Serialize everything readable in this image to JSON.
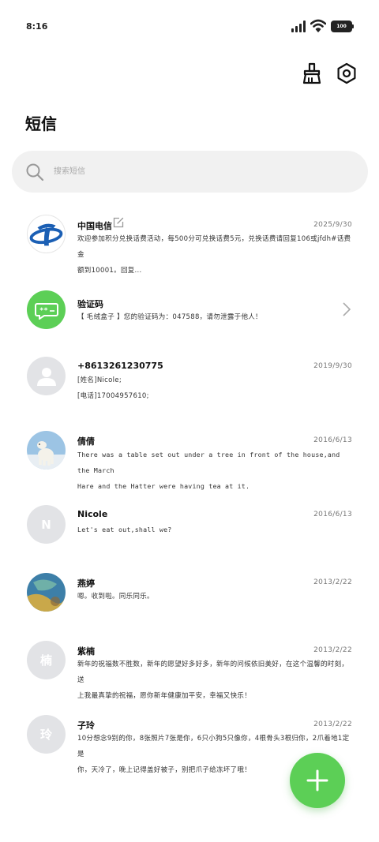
{
  "status_bar": {
    "time": "8:16",
    "battery_level": "100"
  },
  "header": {
    "title": "短信",
    "icons": [
      "brush-icon",
      "settings-icon"
    ]
  },
  "search": {
    "placeholder": "搜索短信",
    "value": ""
  },
  "conversations": [
    {
      "name": "中国电信",
      "date": "2025/9/30",
      "lines": [
        "欢迎参加积分兑换话费活动，每500分可兑换话费5元，兑换话费请回复106或jfdh#话费金",
        "额到10001。回复..."
      ],
      "avatar": "china-telecom-logo",
      "has_edit_icon": true
    },
    {
      "name": "验证码",
      "date": "",
      "lines": [
        "【 毛绒盒子 】您的验证码为：047588，请勿泄露于他人！"
      ],
      "avatar": "sms-bubble-icon",
      "avatar_color": "#5ccf56",
      "has_chevron": true
    },
    {
      "name": "+8613261230775",
      "date": "2019/9/30",
      "lines": [
        "[姓名]Nicole;",
        "[电话]17004957610;"
      ],
      "avatar": "person-icon"
    },
    {
      "name": "倩倩",
      "date": "2016/6/13",
      "lines": [
        "There was a table set out under a tree in front of the house,and the March",
        "Hare and the Hatter were having tea at it."
      ],
      "avatar": "polar-bear-photo"
    },
    {
      "name": "Nicole",
      "date": "2016/6/13",
      "lines": [
        "Let's eat out,shall we?"
      ],
      "avatar_letter": "N"
    },
    {
      "name": "燕婷",
      "date": "2013/2/22",
      "lines": [
        "嗯。收到啦。同乐同乐。"
      ],
      "avatar": "painting-photo"
    },
    {
      "name": "紫楠",
      "date": "2013/2/22",
      "lines": [
        "新年的祝福数不胜数，新年的愿望好多好多，新年的问候依旧美好，在这个温馨的时刻，送",
        "上我最真挚的祝福，愿你新年健康加平安，幸福又快乐！"
      ],
      "avatar_letter": "楠"
    },
    {
      "name": "子玲",
      "date": "2013/2/22",
      "lines": [
        "10分想念9别的你，8张照片7张是你，6只小狗5只像你，4根骨头3根归你，2爪着地1定是",
        "你，天冷了，晚上记得盖好被子，别把爪子给冻坏了哦！"
      ],
      "avatar_letter": "玲"
    }
  ],
  "fab": {
    "icon": "plus-icon",
    "color": "#5ccf56"
  },
  "colors": {
    "accent": "#5ccf56",
    "search_bg": "#f1f1f1",
    "avatar_gray": "#e2e3e6",
    "telecom_blue": "#1b5fb4"
  }
}
